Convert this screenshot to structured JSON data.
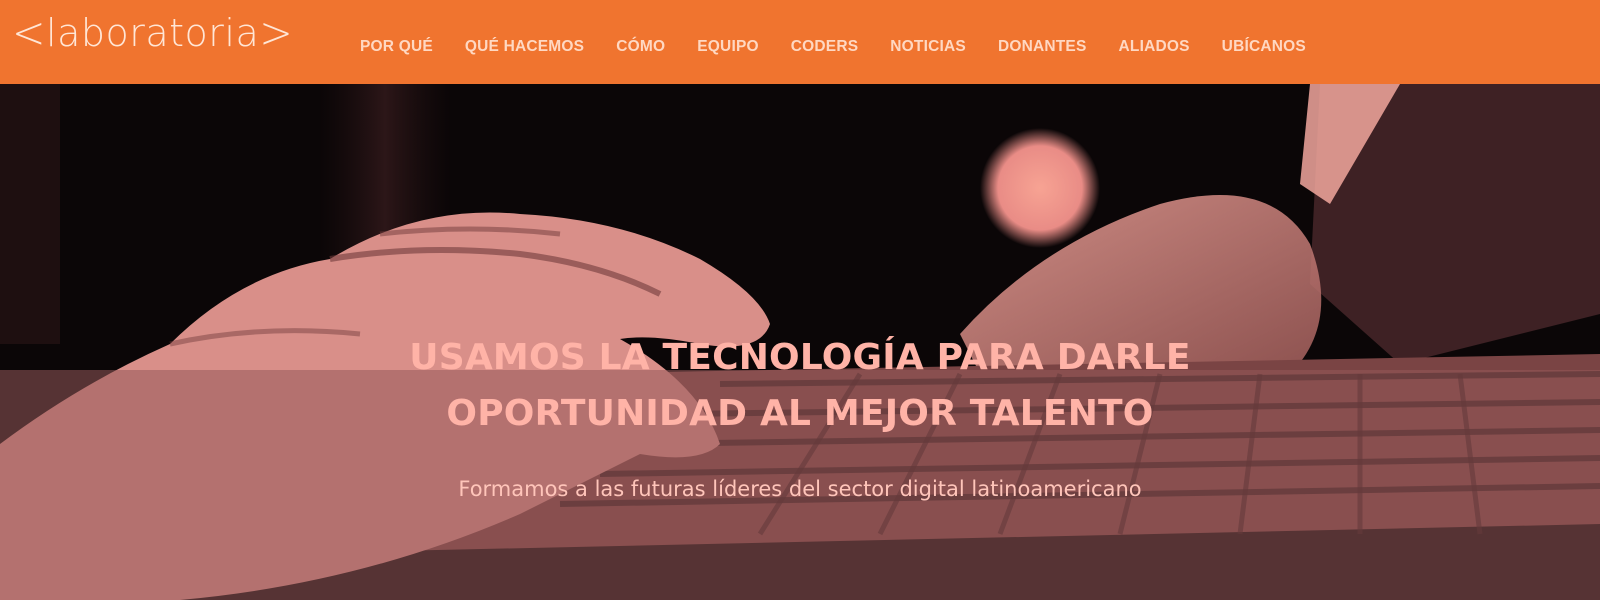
{
  "brand": {
    "logo_open": "<",
    "logo_text": "laboratoria",
    "logo_close": ">"
  },
  "nav": {
    "items": [
      {
        "label": "POR QUÉ"
      },
      {
        "label": "QUÉ HACEMOS"
      },
      {
        "label": "CÓMO"
      },
      {
        "label": "EQUIPO"
      },
      {
        "label": "CODERS"
      },
      {
        "label": "NOTICIAS"
      },
      {
        "label": "DONANTES"
      },
      {
        "label": "ALIADOS"
      },
      {
        "label": "UBÍCANOS"
      }
    ]
  },
  "hero": {
    "headline_line1": "USAMOS LA TECNOLOGÍA PARA DARLE",
    "headline_line2": "OPORTUNIDAD AL MEJOR TALENTO",
    "subheadline": "Formamos a las futuras líderes del sector digital latinoamericano"
  },
  "colors": {
    "accent": "#f0742f",
    "nav_text": "#ffd8c2",
    "hero_text": "#ffb3a7",
    "hero_tint": "#e98c86"
  },
  "icons": {}
}
